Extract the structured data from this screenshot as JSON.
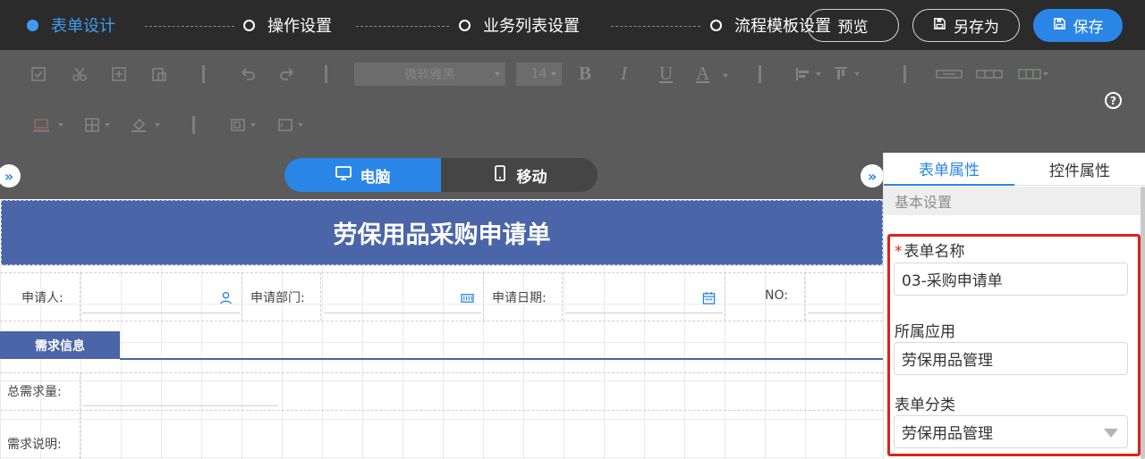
{
  "steps": [
    {
      "label": "表单设计",
      "active": true
    },
    {
      "label": "操作设置",
      "active": false
    },
    {
      "label": "业务列表设置",
      "active": false
    },
    {
      "label": "流程模板设置",
      "active": false
    }
  ],
  "header_buttons": {
    "preview": "预览",
    "save_as": "另存为",
    "save": "保存"
  },
  "toolbar": {
    "font_family": "微软雅黑",
    "font_size": "14",
    "bold": "B",
    "italic": "I",
    "underline": "U",
    "font_color": "A",
    "icons": [
      "checkbox-icon",
      "cut-icon",
      "copy-icon",
      "paste-icon",
      "undo-icon",
      "redo-icon",
      "align-left-icon",
      "align-top-icon",
      "merge-cells-icon",
      "split-cells-icon",
      "table-style-icon",
      "border-color-icon",
      "grid-icon",
      "fill-color-icon",
      "insert-field-icon",
      "insert-control-icon",
      "help-icon"
    ]
  },
  "device_toggle": {
    "desktop": "电脑",
    "mobile": "移动",
    "active": "desktop"
  },
  "form": {
    "title": "劳保用品采购申请单",
    "fields": [
      {
        "label": "申请人:",
        "icon": "user-icon"
      },
      {
        "label": "申请部门:",
        "icon": "org-icon"
      },
      {
        "label": "申请日期:",
        "icon": "calendar-icon"
      },
      {
        "label": "NO:",
        "icon": ""
      }
    ],
    "section": "需求信息",
    "rows": [
      {
        "label": "总需求量:"
      },
      {
        "label": "需求说明:"
      }
    ]
  },
  "panel": {
    "tabs": [
      {
        "label": "表单属性",
        "active": true
      },
      {
        "label": "控件属性",
        "active": false
      }
    ],
    "section_title": "基本设置",
    "form_name_label": "表单名称",
    "form_name_required": "*",
    "form_name_value": "03-采购申请单",
    "app_label": "所属应用",
    "app_value": "劳保用品管理",
    "category_label": "表单分类",
    "category_value": "劳保用品管理"
  },
  "colors": {
    "accent": "#2a86e6",
    "active_step": "#3f9bf2",
    "form_header": "#4a65a8",
    "highlight": "#e0201b",
    "topbar": "#2b2b2c",
    "dim_toolbar": "#5b5b5b"
  }
}
